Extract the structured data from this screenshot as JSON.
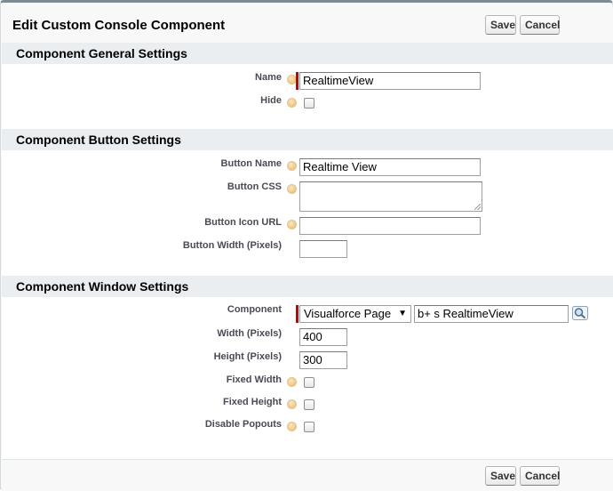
{
  "header": {
    "title": "Edit Custom Console Component",
    "save_label": "Save",
    "cancel_label": "Cancel"
  },
  "general": {
    "title": "Component General Settings",
    "name_label": "Name",
    "name_value": "RealtimeView",
    "hide_label": "Hide",
    "hide_checked": false
  },
  "button": {
    "title": "Component Button Settings",
    "name_label": "Button Name",
    "name_value": "Realtime View",
    "css_label": "Button CSS",
    "css_value": "",
    "icon_url_label": "Button Icon URL",
    "icon_url_value": "",
    "width_label": "Button Width (Pixels)",
    "width_value": ""
  },
  "window": {
    "title": "Component Window Settings",
    "component_label": "Component",
    "component_type": "Visualforce Page",
    "component_value": "b+ s RealtimeView",
    "width_label": "Width (Pixels)",
    "width_value": "400",
    "height_label": "Height (Pixels)",
    "height_value": "300",
    "fixed_width_label": "Fixed Width",
    "fixed_height_label": "Fixed Height",
    "disable_popouts_label": "Disable Popouts"
  },
  "footer": {
    "save_label": "Save",
    "cancel_label": "Cancel"
  },
  "icons": {
    "help": "help-icon",
    "lookup": "lookup-magnifier-icon",
    "dropdown": "chevron-down-icon"
  },
  "colors": {
    "required": "#cc0000",
    "section_header_bg": "#eaeef1",
    "help_icon": "#eab563"
  }
}
